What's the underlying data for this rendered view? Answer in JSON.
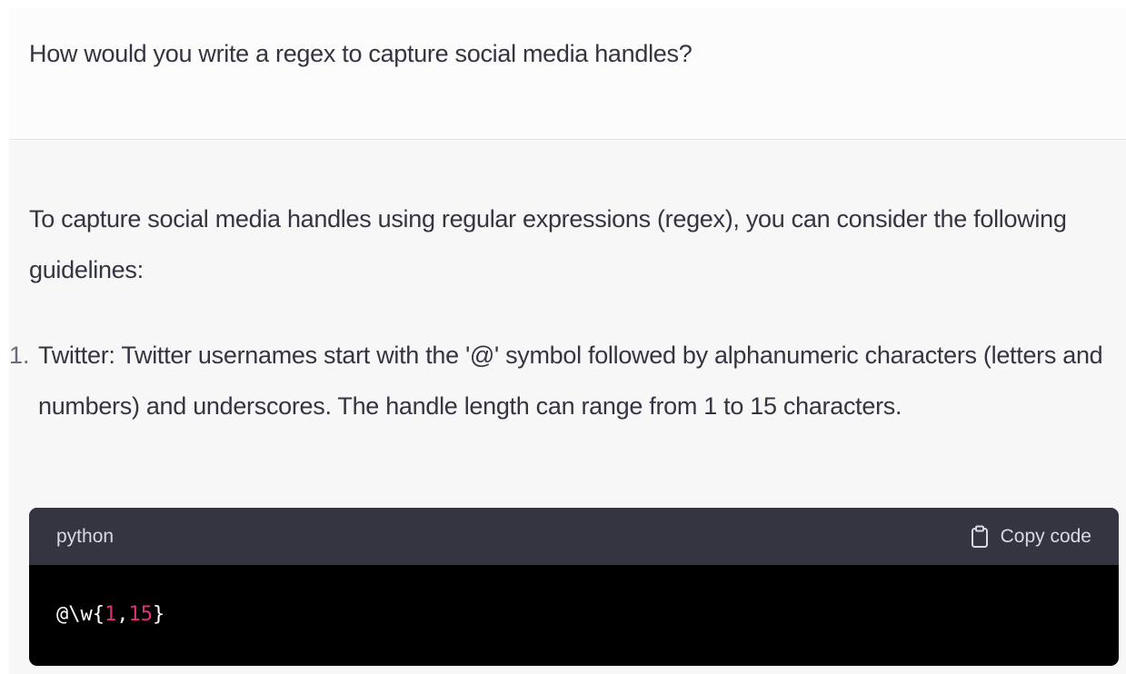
{
  "user_message": {
    "text": "How would you write a regex to capture social media handles?"
  },
  "assistant_message": {
    "intro": "To capture social media handles using regular expressions (regex), you can consider the following guidelines:",
    "list": [
      {
        "number": "1.",
        "text": "Twitter: Twitter usernames start with the '@' symbol followed by alphanumeric characters (letters and numbers) and underscores. The handle length can range from 1 to 15 characters."
      }
    ],
    "code_block": {
      "language": "python",
      "copy_label": "Copy code",
      "copy_icon": "clipboard-icon",
      "tokens": {
        "prefix": "@\\w{",
        "num1": "1",
        "comma": ",",
        "num2": "15",
        "suffix": "}"
      },
      "colors": {
        "header_bg": "#343541",
        "body_bg": "#000000",
        "number_token": "#df3079"
      }
    }
  }
}
